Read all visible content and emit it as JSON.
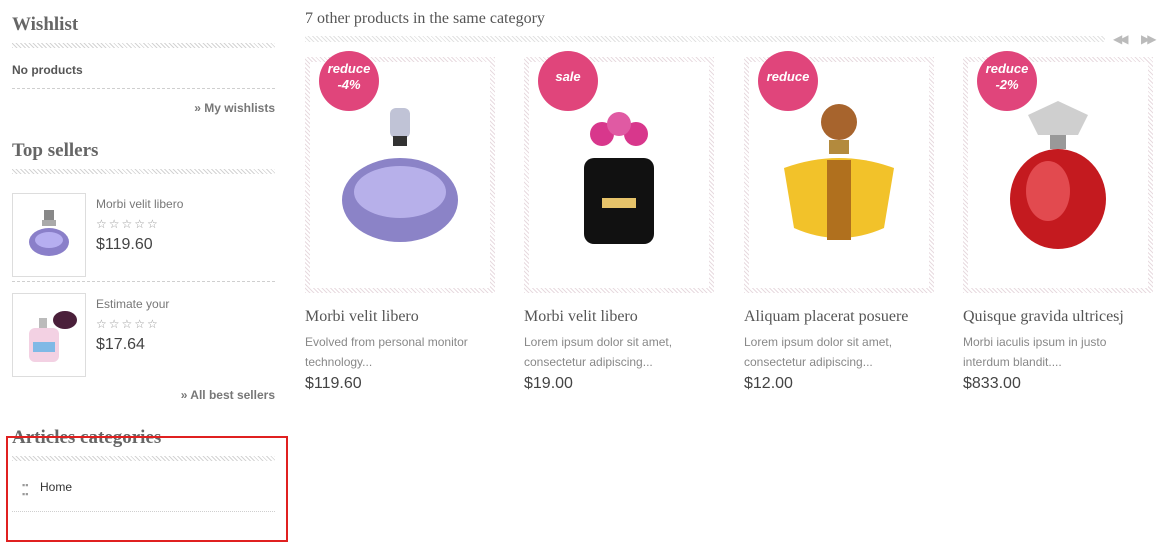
{
  "sidebar": {
    "wishlist": {
      "title": "Wishlist",
      "status": "No products",
      "link": "» My wishlists"
    },
    "top_sellers": {
      "title": "Top sellers",
      "items": [
        {
          "name": "Morbi velit libero",
          "stars": "☆☆☆☆☆",
          "price": "$119.60"
        },
        {
          "name": "Estimate your",
          "stars": "☆☆☆☆☆",
          "price": "$17.64"
        }
      ],
      "link": "» All best sellers"
    },
    "articles_categories": {
      "title": "Articles categories",
      "items": [
        {
          "label": "Home"
        }
      ]
    }
  },
  "main": {
    "title": "7 other products in the same category",
    "products": [
      {
        "name": "Morbi velit libero",
        "desc": "Evolved from personal monitor technology...",
        "price": "$119.60",
        "badge_top": "reduce",
        "badge_bottom": "-4%"
      },
      {
        "name": "Morbi velit libero",
        "desc": "Lorem ipsum dolor sit amet, consectetur adipiscing...",
        "price": "$19.00",
        "badge_top": "sale",
        "badge_bottom": ""
      },
      {
        "name": "Aliquam placerat posuere",
        "desc": "Lorem ipsum dolor sit amet, consectetur adipiscing...",
        "price": "$12.00",
        "badge_top": "reduce",
        "badge_bottom": ""
      },
      {
        "name": "Quisque gravida ultricesj",
        "desc": "Morbi iaculis ipsum in justo interdum blandit....",
        "price": "$833.00",
        "badge_top": "reduce",
        "badge_bottom": "-2%"
      }
    ]
  },
  "colors": {
    "badge": "#e0457b",
    "highlight_box": "#e02020"
  }
}
